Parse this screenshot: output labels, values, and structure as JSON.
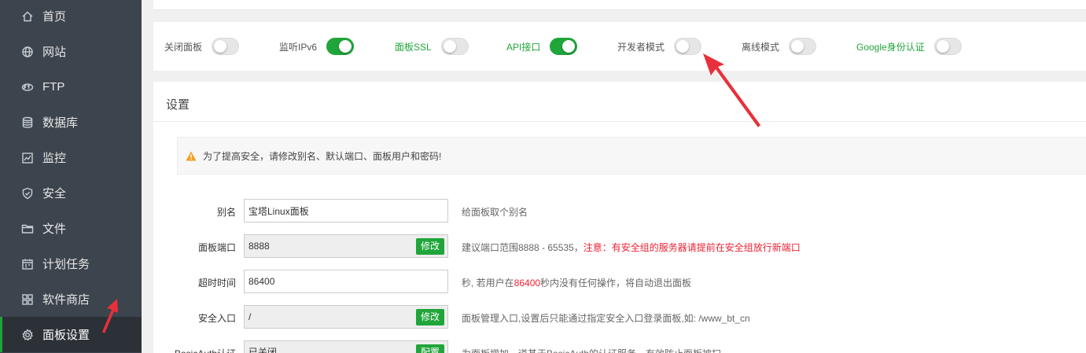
{
  "sidebar": {
    "items": [
      {
        "label": "首页",
        "icon": "home-icon"
      },
      {
        "label": "网站",
        "icon": "globe-icon"
      },
      {
        "label": "FTP",
        "icon": "ftp-icon"
      },
      {
        "label": "数据库",
        "icon": "database-icon"
      },
      {
        "label": "监控",
        "icon": "monitor-icon"
      },
      {
        "label": "安全",
        "icon": "shield-icon"
      },
      {
        "label": "文件",
        "icon": "folder-icon"
      },
      {
        "label": "计划任务",
        "icon": "calendar-icon"
      },
      {
        "label": "软件商店",
        "icon": "grid-icon"
      },
      {
        "label": "面板设置",
        "icon": "gear-icon",
        "active": true
      }
    ]
  },
  "switches": [
    {
      "label": "关闭面板",
      "on": false,
      "label_color": "gray"
    },
    {
      "label": "监听IPv6",
      "on": true,
      "label_color": "gray"
    },
    {
      "label": "面板SSL",
      "on": false,
      "label_color": "green"
    },
    {
      "label": "API接口",
      "on": true,
      "label_color": "green"
    },
    {
      "label": "开发者模式",
      "on": false,
      "label_color": "gray"
    },
    {
      "label": "离线模式",
      "on": false,
      "label_color": "gray"
    },
    {
      "label": "Google身份认证",
      "on": false,
      "label_color": "green"
    }
  ],
  "settings": {
    "title": "设置",
    "notice": "为了提高安全，请修改别名、默认端口、面板用户和密码!",
    "rows": [
      {
        "label": "别名",
        "value": "宝塔Linux面板",
        "hint": "给面板取个别名"
      },
      {
        "label": "面板端口",
        "value": "8888",
        "button": "修改",
        "hint_prefix": "建议端口范围8888 - 65535，",
        "hint_red": "注意：有安全组的服务器请提前在安全组放行新端口"
      },
      {
        "label": "超时时间",
        "value": "86400",
        "hint_prefix": "秒, 若用户在",
        "hint_red": "86400",
        "hint_suffix": "秒内没有任何操作，将自动退出面板"
      },
      {
        "label": "安全入口",
        "value": "/",
        "button": "修改",
        "hint": "面板管理入口,设置后只能通过指定安全入口登录面板,如: /www_bt_cn"
      },
      {
        "label": "BasicAuth认证",
        "value": "已关闭",
        "button": "配置",
        "hint": "为面板增加一道基于BasicAuth的认证服务，有效防止面板被扫"
      }
    ]
  },
  "colors": {
    "accent": "#20a53a",
    "sidebar_bg": "#3c444d",
    "annotation_arrow": "#e8303a"
  }
}
